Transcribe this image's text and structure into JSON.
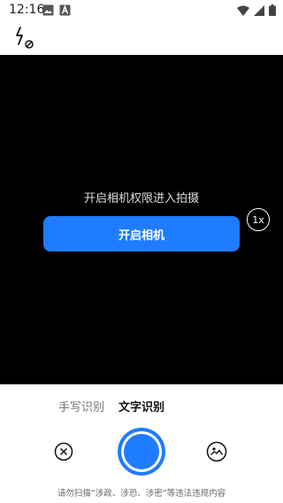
{
  "status_bar": {
    "time": "12:16",
    "icons": [
      "image-notification-icon",
      "a-notification-icon",
      "wifi-icon",
      "signal-icon",
      "battery-icon"
    ]
  },
  "top_bar": {
    "flash_icon": "flash-off-icon"
  },
  "camera": {
    "permission_text": "开启相机权限进入拍摄",
    "open_button_label": "开启相机",
    "zoom_label": "1x"
  },
  "modes": {
    "handwriting": "手写识别",
    "text": "文字识别",
    "selected": "文字识别"
  },
  "controls": {
    "cancel_icon": "close-circle-icon",
    "shutter_icon": "shutter-icon",
    "gallery_icon": "gallery-icon"
  },
  "disclaimer": "请勿扫描“涉政、涉恐、涉密”等违法违规内容",
  "colors": {
    "accent": "#1f7bff",
    "camera_bg": "#000000"
  }
}
